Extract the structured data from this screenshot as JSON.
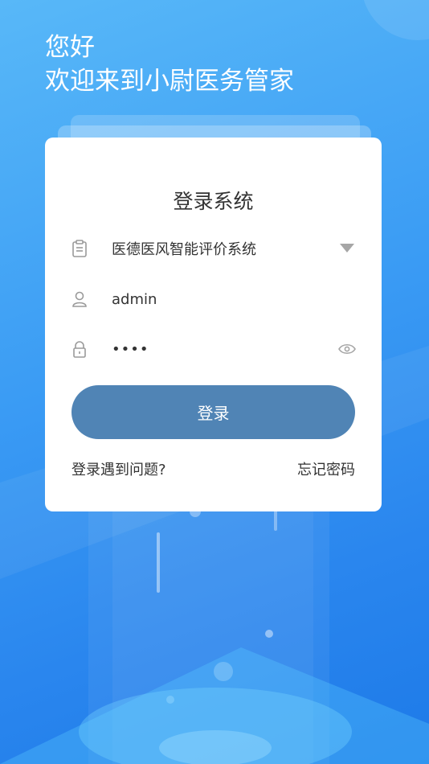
{
  "greeting": {
    "hello": "您好",
    "welcome": "欢迎来到小尉医务管家"
  },
  "login": {
    "title": "登录系统",
    "system_select": {
      "value": "医德医风智能评价系统",
      "icon": "clipboard-icon"
    },
    "username": {
      "value": "admin",
      "icon": "user-icon"
    },
    "password": {
      "value": "••••",
      "icon": "lock-icon"
    },
    "submit_label": "登录",
    "help_link": "登录遇到问题?",
    "forgot_link": "忘记密码"
  },
  "colors": {
    "background": "#3a9bf4",
    "button": "#5084b5",
    "card": "#ffffff"
  }
}
